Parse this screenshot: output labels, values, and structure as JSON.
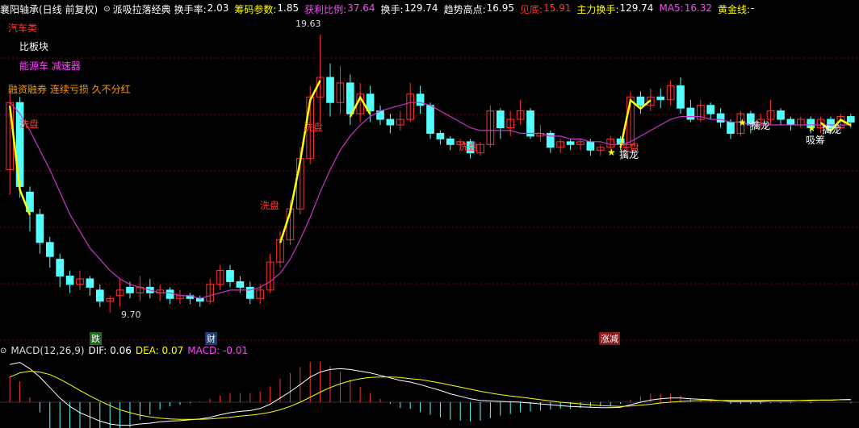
{
  "header": {
    "stock_name": "襄阳轴承(日线 前复权)",
    "indicator": "派吸拉落经典",
    "items": [
      {
        "label": "换手率:",
        "value": "2.03",
        "lc": "w",
        "vc": "w"
      },
      {
        "label": "筹码参数:",
        "value": "1.85",
        "lc": "y",
        "vc": "w"
      },
      {
        "label": "获利比例:",
        "value": "37.64",
        "lc": "m",
        "vc": "m"
      },
      {
        "label": "换手:",
        "value": "129.74",
        "lc": "w",
        "vc": "w"
      },
      {
        "label": "趋势高点:",
        "value": "16.95",
        "lc": "w",
        "vc": "w"
      },
      {
        "label": "见底:",
        "value": "15.91",
        "lc": "r",
        "vc": "r"
      },
      {
        "label": "主力换手:",
        "value": "129.74",
        "lc": "y",
        "vc": "w"
      },
      {
        "label": "MA5:",
        "value": "16.32",
        "lc": "m",
        "vc": "m"
      },
      {
        "label": "黄金线:",
        "value": "-",
        "lc": "y",
        "vc": "w"
      }
    ]
  },
  "overlay": {
    "sector1": "汽车类",
    "sector2": "比板块",
    "sector3": "能源车 减速器",
    "sector4": "融资融券 连续亏损 久不分红",
    "high_label": "19.63",
    "low_label": "9.70",
    "xipan": "洗盘",
    "qinlong": "擒龙",
    "xichou": "吸筹",
    "qiaopen": "擒龙"
  },
  "tags": {
    "die": "跌",
    "cai": "财",
    "zhang": "涨减"
  },
  "macd": {
    "label": "MACD(12,26,9)",
    "dif": "DIF: 0.06",
    "dea": "DEA: 0.07",
    "macd": "MACD: -0.01"
  },
  "colors": {
    "up": "#ff3333",
    "down": "#54ffff",
    "ma": "#cc33cc",
    "signal": "#ffff00",
    "grid": "#8b0000"
  },
  "chart_data": {
    "type": "candlestick",
    "price_high_marked": 19.63,
    "price_low_marked": 9.7,
    "candles": [
      [
        14.8,
        17.2,
        13.9,
        17.6
      ],
      [
        17.2,
        14.2,
        13.8,
        17.4
      ],
      [
        14.0,
        13.3,
        12.6,
        14.2
      ],
      [
        13.2,
        12.2,
        11.8,
        13.4
      ],
      [
        12.2,
        11.7,
        11.3,
        12.4
      ],
      [
        11.6,
        11.0,
        10.6,
        11.8
      ],
      [
        11.0,
        10.7,
        10.4,
        11.2
      ],
      [
        10.7,
        10.9,
        10.5,
        11.2
      ],
      [
        10.9,
        10.6,
        10.3,
        11.0
      ],
      [
        10.5,
        10.1,
        9.9,
        10.7
      ],
      [
        10.1,
        10.2,
        9.7,
        10.3
      ],
      [
        10.3,
        10.5,
        9.9,
        10.9
      ],
      [
        10.6,
        10.4,
        10.2,
        10.8
      ],
      [
        10.4,
        10.6,
        10.1,
        11.0
      ],
      [
        10.6,
        10.4,
        10.2,
        10.9
      ],
      [
        10.4,
        10.5,
        10.1,
        10.7
      ],
      [
        10.5,
        10.2,
        10.0,
        10.6
      ],
      [
        10.2,
        10.3,
        10.0,
        10.5
      ],
      [
        10.3,
        10.2,
        10.0,
        10.4
      ],
      [
        10.2,
        10.1,
        9.9,
        10.3
      ],
      [
        10.1,
        10.7,
        10.0,
        10.9
      ],
      [
        10.7,
        11.2,
        10.5,
        11.4
      ],
      [
        11.2,
        10.8,
        10.6,
        11.4
      ],
      [
        10.8,
        10.6,
        10.4,
        11.0
      ],
      [
        10.6,
        10.2,
        10.0,
        10.8
      ],
      [
        10.2,
        10.5,
        10.0,
        10.7
      ],
      [
        10.5,
        11.5,
        10.4,
        11.8
      ],
      [
        11.5,
        12.3,
        11.3,
        12.6
      ],
      [
        12.3,
        13.4,
        12.1,
        13.7
      ],
      [
        13.4,
        15.2,
        13.2,
        15.6
      ],
      [
        15.2,
        17.4,
        15.0,
        17.8
      ],
      [
        17.4,
        18.1,
        16.5,
        19.63
      ],
      [
        18.1,
        17.2,
        16.7,
        18.6
      ],
      [
        17.2,
        17.9,
        16.8,
        18.5
      ],
      [
        17.9,
        16.8,
        16.4,
        18.2
      ],
      [
        16.8,
        17.5,
        16.5,
        17.9
      ],
      [
        17.5,
        16.9,
        16.5,
        17.8
      ],
      [
        16.9,
        16.6,
        16.4,
        17.1
      ],
      [
        16.6,
        16.4,
        16.1,
        16.8
      ],
      [
        16.4,
        16.6,
        16.2,
        16.9
      ],
      [
        16.6,
        17.5,
        16.5,
        17.9
      ],
      [
        17.5,
        17.1,
        16.8,
        17.8
      ],
      [
        17.1,
        16.1,
        15.9,
        17.2
      ],
      [
        16.1,
        15.9,
        15.7,
        16.2
      ],
      [
        15.9,
        15.7,
        15.5,
        16.0
      ],
      [
        15.7,
        15.8,
        15.5,
        15.9
      ],
      [
        15.8,
        15.4,
        15.2,
        15.9
      ],
      [
        15.4,
        15.7,
        15.3,
        15.8
      ],
      [
        15.7,
        16.9,
        15.6,
        17.1
      ],
      [
        16.9,
        16.3,
        15.9,
        17.0
      ],
      [
        16.3,
        16.6,
        16.0,
        16.9
      ],
      [
        16.6,
        16.9,
        16.4,
        17.3
      ],
      [
        16.9,
        16.0,
        15.9,
        17.0
      ],
      [
        16.0,
        16.1,
        15.8,
        16.4
      ],
      [
        16.1,
        15.6,
        15.4,
        16.2
      ],
      [
        15.6,
        15.8,
        15.4,
        15.9
      ],
      [
        15.8,
        15.7,
        15.5,
        15.9
      ],
      [
        15.7,
        15.8,
        15.5,
        15.9
      ],
      [
        15.8,
        15.5,
        15.3,
        15.9
      ],
      [
        15.5,
        15.6,
        15.3,
        15.7
      ],
      [
        15.6,
        15.9,
        15.5,
        16.0
      ],
      [
        15.9,
        15.7,
        15.5,
        16.0
      ],
      [
        15.7,
        17.4,
        15.6,
        17.6
      ],
      [
        17.4,
        17.1,
        16.8,
        17.6
      ],
      [
        17.1,
        17.4,
        16.9,
        17.7
      ],
      [
        17.4,
        17.3,
        17.0,
        17.7
      ],
      [
        17.3,
        17.8,
        17.1,
        18.0
      ],
      [
        17.8,
        17.0,
        16.8,
        18.1
      ],
      [
        17.0,
        16.6,
        16.5,
        17.3
      ],
      [
        16.6,
        17.1,
        16.5,
        17.3
      ],
      [
        17.1,
        16.8,
        16.6,
        17.2
      ],
      [
        16.8,
        16.5,
        16.3,
        17.0
      ],
      [
        16.5,
        16.1,
        15.9,
        16.6
      ],
      [
        16.1,
        16.8,
        16.0,
        16.9
      ],
      [
        16.8,
        16.4,
        16.1,
        16.9
      ],
      [
        16.4,
        16.6,
        16.3,
        16.8
      ],
      [
        16.6,
        16.9,
        16.4,
        17.3
      ],
      [
        16.9,
        16.6,
        16.4,
        17.0
      ],
      [
        16.6,
        16.4,
        16.2,
        16.7
      ],
      [
        16.4,
        16.6,
        16.3,
        16.7
      ],
      [
        16.6,
        16.3,
        16.1,
        16.7
      ],
      [
        16.3,
        16.6,
        16.1,
        16.7
      ],
      [
        16.6,
        16.3,
        16.1,
        16.7
      ],
      [
        16.3,
        16.7,
        16.2,
        16.8
      ],
      [
        16.7,
        16.5,
        16.3,
        16.8
      ]
    ],
    "ma": [
      17.2,
      16.8,
      16.2,
      15.5,
      14.8,
      14.0,
      13.2,
      12.6,
      12.0,
      11.6,
      11.2,
      10.9,
      10.7,
      10.6,
      10.5,
      10.4,
      10.4,
      10.3,
      10.3,
      10.2,
      10.3,
      10.4,
      10.5,
      10.5,
      10.5,
      10.6,
      10.8,
      11.1,
      11.6,
      12.3,
      13.1,
      14.0,
      14.8,
      15.5,
      16.0,
      16.4,
      16.7,
      16.9,
      17.0,
      17.1,
      17.2,
      17.2,
      17.1,
      16.9,
      16.7,
      16.5,
      16.3,
      16.2,
      16.2,
      16.2,
      16.2,
      16.1,
      16.1,
      16.1,
      16.0,
      16.0,
      15.9,
      15.9,
      15.8,
      15.8,
      15.7,
      15.7,
      15.8,
      16.0,
      16.2,
      16.4,
      16.6,
      16.7,
      16.7,
      16.7,
      16.6,
      16.6,
      16.5,
      16.5,
      16.4,
      16.4,
      16.4,
      16.4,
      16.4,
      16.4,
      16.4,
      16.4,
      16.4,
      16.4,
      16.4
    ],
    "macd_dif": [
      0.9,
      0.95,
      0.8,
      0.6,
      0.35,
      0.1,
      -0.1,
      -0.25,
      -0.35,
      -0.45,
      -0.52,
      -0.55,
      -0.55,
      -0.52,
      -0.5,
      -0.47,
      -0.45,
      -0.44,
      -0.42,
      -0.4,
      -0.36,
      -0.3,
      -0.25,
      -0.22,
      -0.2,
      -0.15,
      -0.05,
      0.1,
      0.25,
      0.42,
      0.6,
      0.72,
      0.78,
      0.8,
      0.78,
      0.74,
      0.7,
      0.64,
      0.58,
      0.52,
      0.48,
      0.42,
      0.35,
      0.28,
      0.2,
      0.14,
      0.08,
      0.04,
      0.03,
      0.02,
      0.01,
      0.0,
      -0.02,
      -0.04,
      -0.06,
      -0.08,
      -0.1,
      -0.11,
      -0.12,
      -0.13,
      -0.13,
      -0.12,
      -0.06,
      0.0,
      0.05,
      0.08,
      0.1,
      0.1,
      0.08,
      0.07,
      0.06,
      0.04,
      0.02,
      0.02,
      0.02,
      0.02,
      0.03,
      0.03,
      0.03,
      0.04,
      0.04,
      0.05,
      0.05,
      0.06,
      0.06
    ],
    "macd_dea": [
      0.6,
      0.7,
      0.74,
      0.72,
      0.66,
      0.55,
      0.42,
      0.28,
      0.15,
      0.03,
      -0.08,
      -0.18,
      -0.25,
      -0.31,
      -0.35,
      -0.38,
      -0.4,
      -0.41,
      -0.41,
      -0.41,
      -0.4,
      -0.38,
      -0.36,
      -0.33,
      -0.31,
      -0.28,
      -0.24,
      -0.18,
      -0.1,
      0.0,
      0.12,
      0.24,
      0.35,
      0.44,
      0.51,
      0.56,
      0.59,
      0.6,
      0.6,
      0.59,
      0.56,
      0.54,
      0.5,
      0.46,
      0.41,
      0.36,
      0.31,
      0.26,
      0.22,
      0.18,
      0.15,
      0.12,
      0.09,
      0.06,
      0.03,
      0.0,
      -0.02,
      -0.04,
      -0.06,
      -0.08,
      -0.09,
      -0.1,
      -0.09,
      -0.07,
      -0.05,
      -0.02,
      0.0,
      0.02,
      0.03,
      0.04,
      0.04,
      0.04,
      0.04,
      0.04,
      0.04,
      0.04,
      0.04,
      0.04,
      0.04,
      0.04,
      0.05,
      0.05,
      0.05,
      0.06,
      0.07
    ]
  }
}
